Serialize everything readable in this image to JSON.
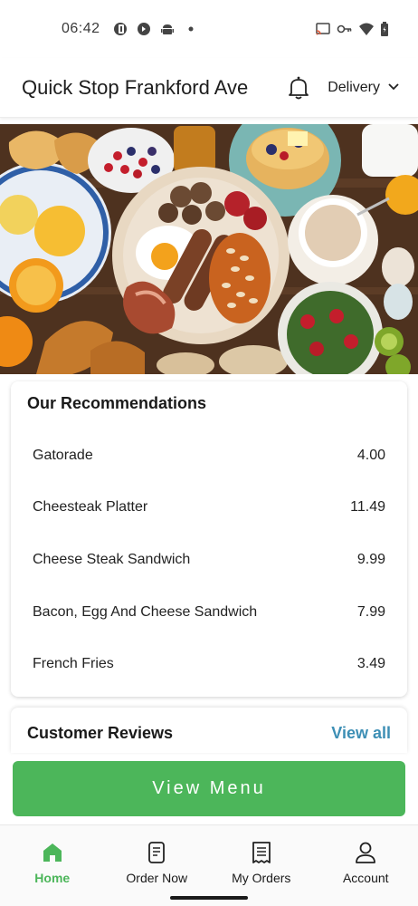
{
  "status_bar": {
    "time": "06:42",
    "left_icons": [
      "pie-app-icon",
      "shazam-icon",
      "android-icon",
      "dot-icon"
    ],
    "right_icons": [
      "cast-icon",
      "key-icon",
      "wifi-icon",
      "battery-icon"
    ]
  },
  "header": {
    "store_name": "Quick Stop Frankford Ave",
    "delivery_label": "Delivery"
  },
  "recommendations": {
    "title": "Our Recommendations",
    "items": [
      {
        "name": "Gatorade",
        "price": "4.00"
      },
      {
        "name": "Cheesteak Platter",
        "price": "11.49"
      },
      {
        "name": "Cheese Steak Sandwich",
        "price": "9.99"
      },
      {
        "name": "Bacon, Egg And Cheese Sandwich",
        "price": "7.99"
      },
      {
        "name": "French Fries",
        "price": "3.49"
      }
    ]
  },
  "reviews": {
    "title": "Customer Reviews",
    "view_all": "View all"
  },
  "view_menu_label": "View Menu",
  "bottom_nav": {
    "items": [
      {
        "label": "Home",
        "icon": "home-icon"
      },
      {
        "label": "Order Now",
        "icon": "order-now-icon"
      },
      {
        "label": "My Orders",
        "icon": "receipt-icon"
      },
      {
        "label": "Account",
        "icon": "account-icon"
      }
    ],
    "active": "Home"
  },
  "colors": {
    "accent_green": "#4cb65a",
    "link_blue": "#3d8fb5"
  }
}
